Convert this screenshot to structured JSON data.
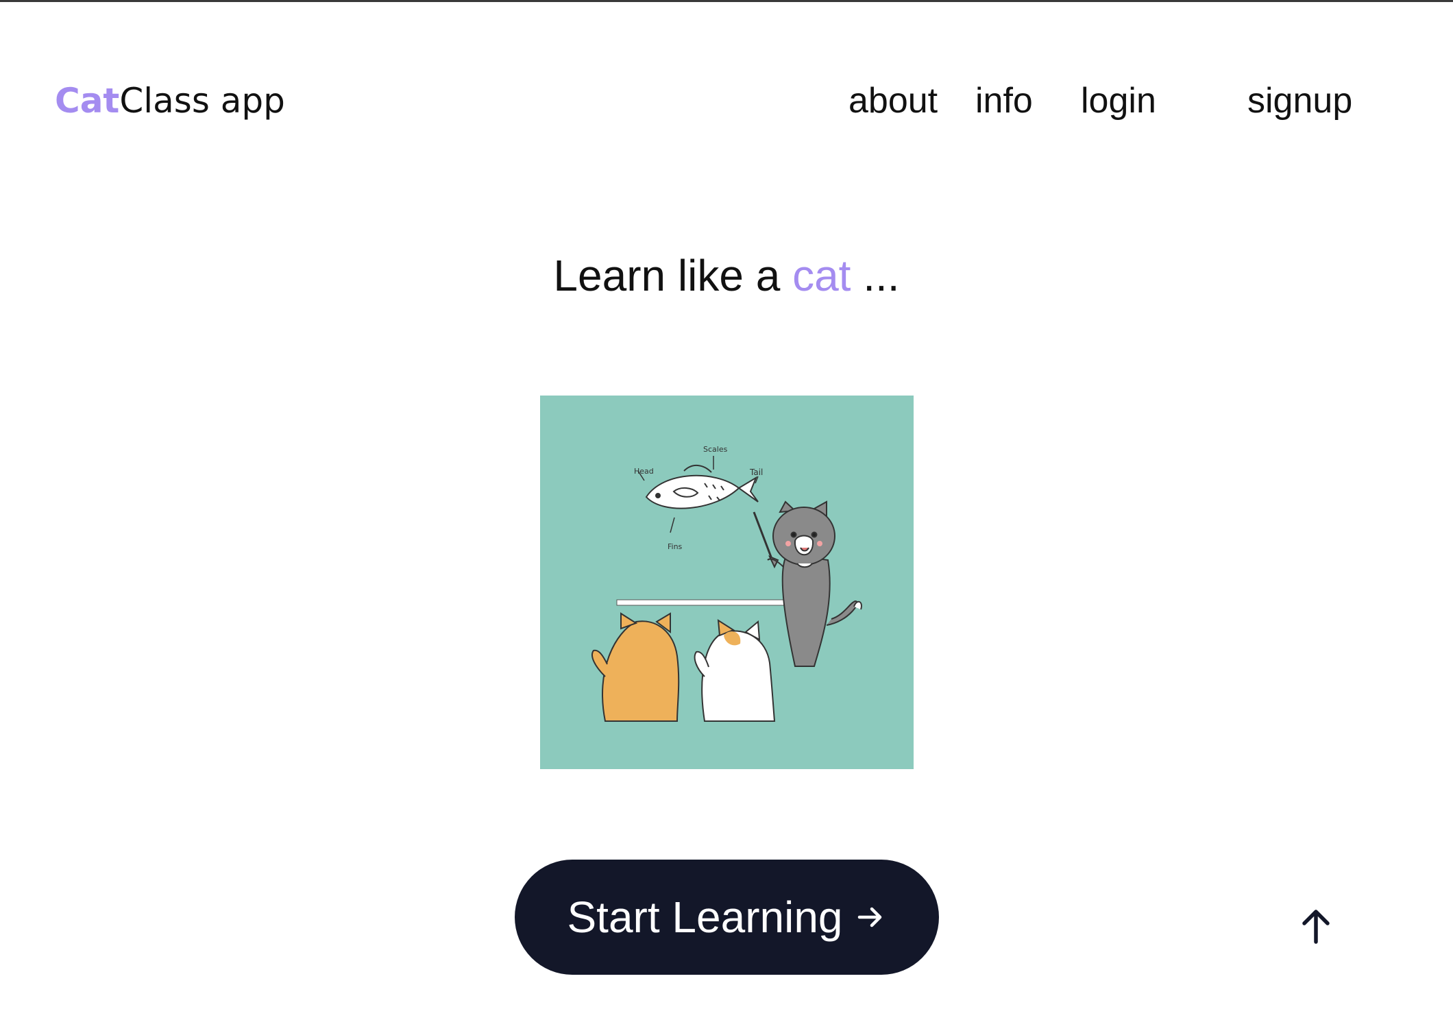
{
  "header": {
    "logo_accent": "Cat",
    "logo_rest": "Class app",
    "nav": {
      "about": "about",
      "info": "info",
      "login": "login",
      "signup": "signup"
    }
  },
  "hero": {
    "headline_start": "Learn like a ",
    "headline_accent": "cat",
    "headline_end": " ...",
    "illustration": {
      "label_head": "Head",
      "label_scales": "Scales",
      "label_tail": "Tail",
      "label_fins": "Fins"
    },
    "cta_label": "Start Learning"
  },
  "icons": {
    "cta_arrow": "arrow-right-icon",
    "scroll_top": "arrow-up-icon"
  },
  "colors": {
    "accent": "#a48cf0",
    "button_bg": "#131729",
    "illustration_bg": "#8ccabd"
  }
}
